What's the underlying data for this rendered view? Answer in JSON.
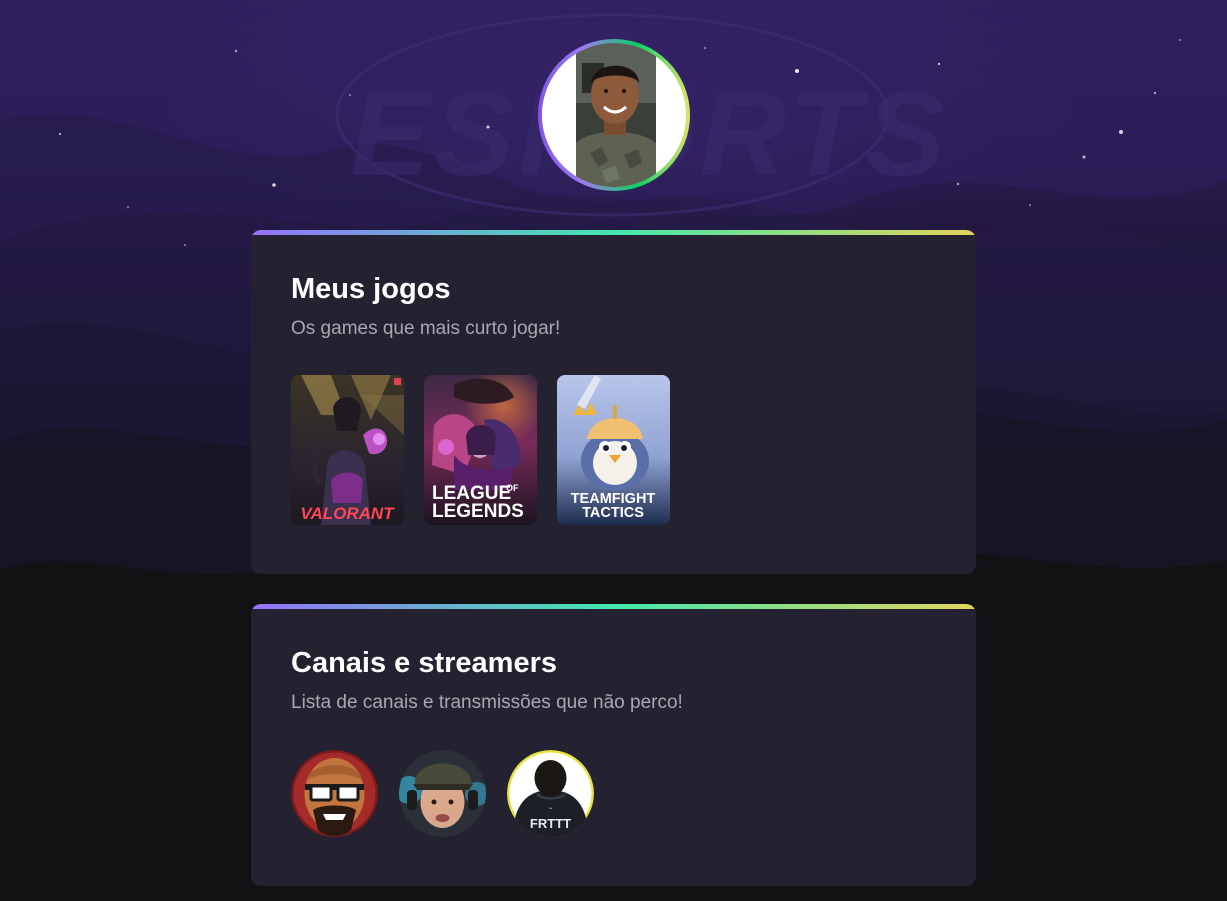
{
  "background": {
    "watermark_text": "ESPORTS"
  },
  "profile": {
    "avatar_alt": "profile-avatar"
  },
  "games_section": {
    "title": "Meus jogos",
    "subtitle": "Os games que mais curto jogar!",
    "games": [
      {
        "name": "VALORANT",
        "logo_text": "VALORANT"
      },
      {
        "name": "League of Legends",
        "logo_line1": "LEAGUE",
        "logo_of": "OF",
        "logo_line2": "LEGENDS"
      },
      {
        "name": "Teamfight Tactics",
        "logo_line1": "TEAMFIGHT",
        "logo_line2": "TACTICS"
      }
    ]
  },
  "streams_section": {
    "title": "Canais e streamers",
    "subtitle": "Lista de canais e transmissões que não perco!",
    "streamers": [
      {
        "id": "streamer-1"
      },
      {
        "id": "streamer-2"
      },
      {
        "id": "streamer-3",
        "shirt_text": "FRTTT"
      }
    ]
  },
  "colors": {
    "page_bg": "#121214",
    "card_bg": "#242130",
    "title": "#ffffff",
    "subtitle": "#a8a8b3",
    "gradient_start": "#9572fc",
    "gradient_mid": "#43e7ad",
    "gradient_end": "#e2d45c"
  }
}
